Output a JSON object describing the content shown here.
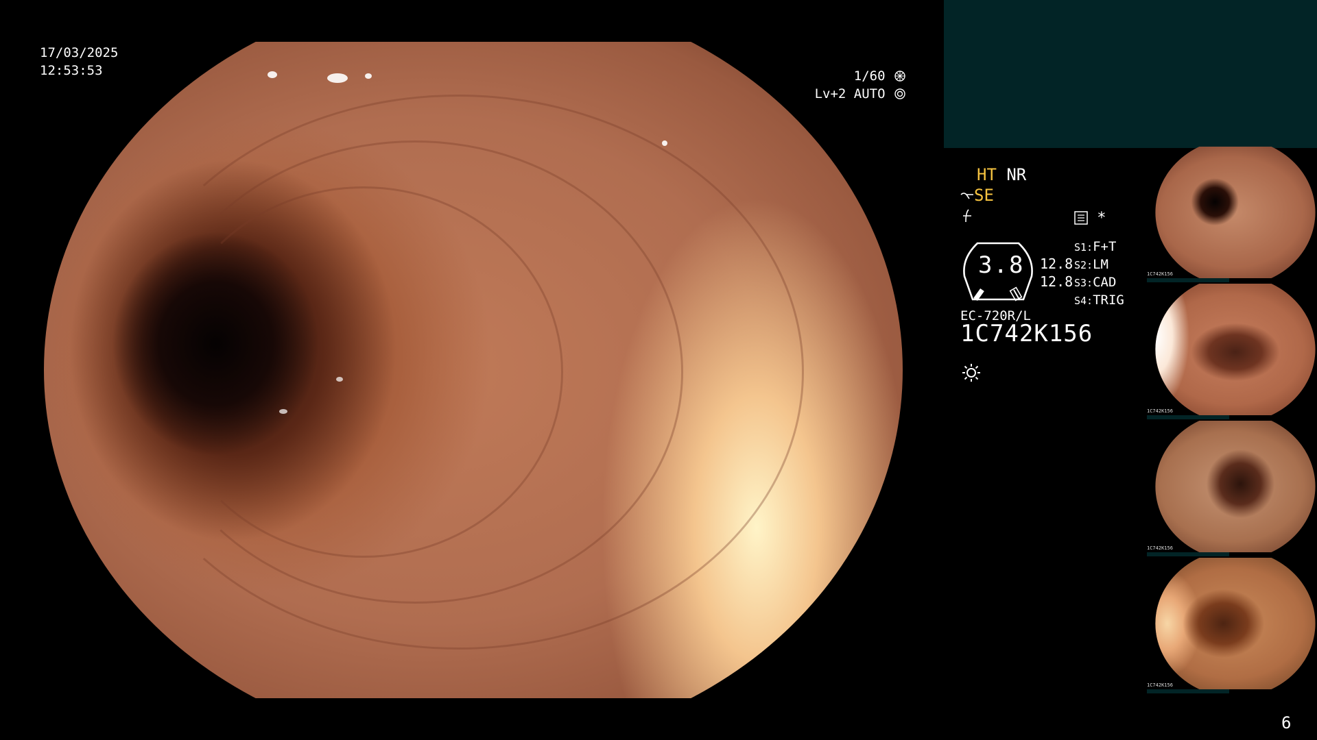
{
  "overlay": {
    "date": "17/03/2025",
    "time": "12:53:53",
    "shutter": "1/60",
    "iris": "Lv+2 AUTO"
  },
  "panel": {
    "mode_ht": "HT",
    "mode_nr": "NR",
    "se_label": "SE",
    "memo_star": "*",
    "gauge_value": "3.8",
    "reading_1": "12.8",
    "reading_2": "12.8",
    "switches": [
      {
        "key": "S1:",
        "value": "F+T"
      },
      {
        "key": "S2:",
        "value": "LM"
      },
      {
        "key": "S3:",
        "value": "CAD"
      },
      {
        "key": "S4:",
        "value": "TRIG"
      }
    ],
    "scope_model": "EC-720R/L",
    "scope_serial": "1C742K156"
  },
  "thumbnails": [
    {
      "label": "1C742K156"
    },
    {
      "label": "1C742K156"
    },
    {
      "label": "1C742K156"
    },
    {
      "label": "1C742K156"
    }
  ],
  "page_number": "6",
  "colors": {
    "accent_yellow": "#f6c340",
    "panel_teal": "#022426"
  }
}
